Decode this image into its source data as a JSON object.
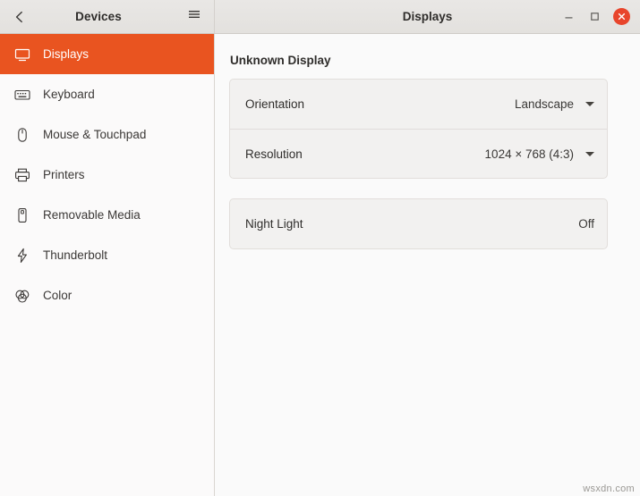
{
  "window": {
    "left_title": "Devices",
    "right_title": "Displays",
    "back_icon": "back-chevron-icon",
    "menu_icon": "hamburger-menu-icon",
    "minimize_label": "—",
    "maximize_label": "□",
    "close_label": "×",
    "accent_color": "#e95420",
    "close_color": "#e8452c"
  },
  "sidebar": {
    "items": [
      {
        "label": "Displays",
        "icon": "display-icon",
        "active": true
      },
      {
        "label": "Keyboard",
        "icon": "keyboard-icon",
        "active": false
      },
      {
        "label": "Mouse & Touchpad",
        "icon": "mouse-icon",
        "active": false
      },
      {
        "label": "Printers",
        "icon": "printer-icon",
        "active": false
      },
      {
        "label": "Removable Media",
        "icon": "removable-media-icon",
        "active": false
      },
      {
        "label": "Thunderbolt",
        "icon": "thunderbolt-icon",
        "active": false
      },
      {
        "label": "Color",
        "icon": "color-icon",
        "active": false
      }
    ]
  },
  "main": {
    "section_title": "Unknown Display",
    "rows": [
      {
        "label": "Orientation",
        "value": "Landscape",
        "has_caret": true
      },
      {
        "label": "Resolution",
        "value": "1024 × 768 (4:3)",
        "has_caret": true
      }
    ],
    "night_light": {
      "label": "Night Light",
      "value": "Off",
      "has_caret": false
    }
  },
  "watermark": "wsxdn.com"
}
